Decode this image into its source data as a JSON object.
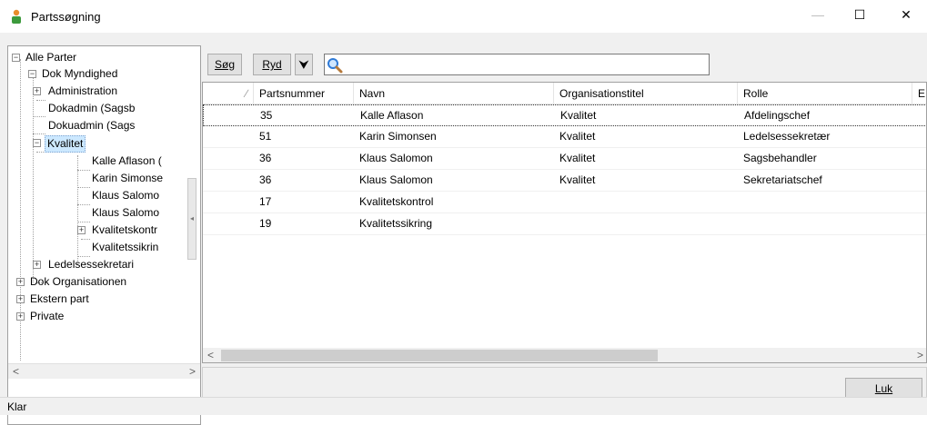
{
  "window": {
    "title": "Partssøgning",
    "minimize_glyph": "—",
    "maximize_glyph": "☐",
    "close_glyph": "✕"
  },
  "tree": {
    "nodes": [
      {
        "label": "Alle Parter",
        "expander": "−"
      },
      {
        "label": "Dok Myndighed",
        "expander": "−"
      },
      {
        "label": "Administration",
        "expander": "+"
      },
      {
        "label": "Dokadmin (Sagsb"
      },
      {
        "label": "Dokuadmin (Sags"
      },
      {
        "label": "Kvalitet",
        "expander": "−"
      },
      {
        "label": "Kalle Aflason ("
      },
      {
        "label": "Karin Simonse"
      },
      {
        "label": "Klaus Salomo"
      },
      {
        "label": "Klaus Salomo"
      },
      {
        "label": "Kvalitetskontr",
        "expander": "+"
      },
      {
        "label": "Kvalitetssikrin"
      },
      {
        "label": "Ledelsessekretari",
        "expander": "+"
      },
      {
        "label": "Dok Organisationen",
        "expander": "+"
      },
      {
        "label": "Ekstern part",
        "expander": "+"
      },
      {
        "label": "Private",
        "expander": "+"
      }
    ],
    "scroll_left": "<",
    "scroll_right": ">"
  },
  "toolbar": {
    "search_label": "Søg",
    "clear_label": "Ryd",
    "expand_glyph": "⮟"
  },
  "grid": {
    "columns": [
      "",
      "Partsnummer",
      "Navn",
      "Organisationstitel",
      "Rolle",
      "E"
    ],
    "rows": [
      [
        "35",
        "Kalle Aflason",
        "Kvalitet",
        "Afdelingschef"
      ],
      [
        "51",
        "Karin Simonsen",
        "Kvalitet",
        "Ledelsessekretær"
      ],
      [
        "36",
        "Klaus Salomon",
        "Kvalitet",
        "Sagsbehandler"
      ],
      [
        "36",
        "Klaus Salomon",
        "Kvalitet",
        "Sekretariatschef"
      ],
      [
        "17",
        "Kvalitetskontrol",
        "",
        ""
      ],
      [
        "19",
        "Kvalitetssikring",
        "",
        ""
      ]
    ],
    "scroll_left": "<",
    "scroll_right": ">"
  },
  "footer": {
    "close_label": "Luk"
  },
  "status": {
    "text": "Klar"
  },
  "colors": {
    "selected": "#cce8ff",
    "icon_green": "#3c9a3c",
    "icon_orange": "#e88d2b"
  }
}
